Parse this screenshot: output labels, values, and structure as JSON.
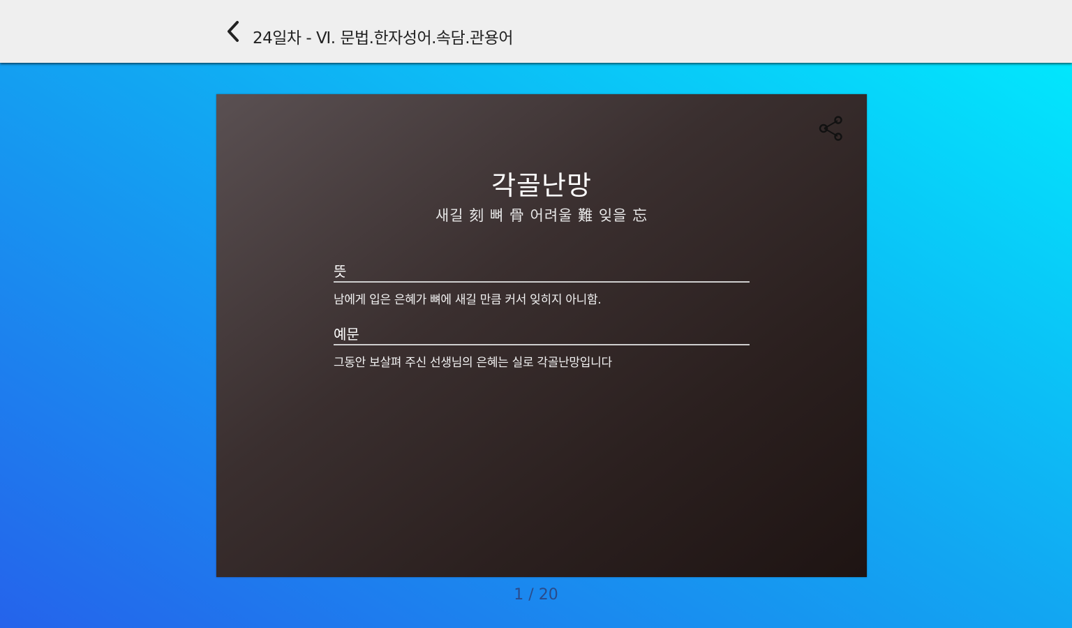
{
  "header": {
    "title": "24일차 - Ⅵ. 문법.한자성어.속담.관용어",
    "back_icon": "chevron-left-icon"
  },
  "card": {
    "share_icon": "share-icon",
    "word": "각골난망",
    "hanja": "새길 刻 뼈 骨 어려울 難 잊을 忘",
    "meaning_label": "뜻",
    "meaning_text": "남에게 입은 은혜가 뼈에 새길 만큼 커서 잊히지 아니함.",
    "example_label": "예문",
    "example_text": "그동안 보살펴 주신 선생님의 은혜는 실로 각골난망입니다"
  },
  "pager": {
    "text": "1 / 20"
  },
  "colors": {
    "topbar": "#efefef",
    "card_dark": "#2b201f",
    "bg_gradient_start": "#2563eb",
    "bg_gradient_end": "#00eefe",
    "pager_text": "#2a4b8a"
  }
}
